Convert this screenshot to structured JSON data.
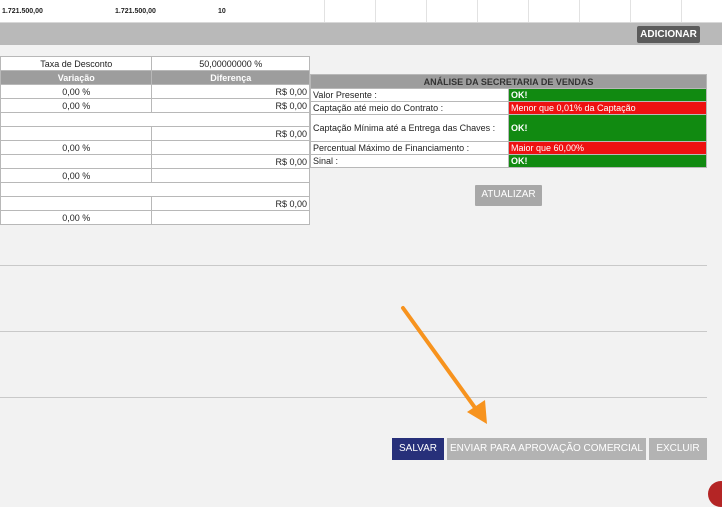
{
  "summary_row": {
    "val1": "1.721.500,00",
    "val2": "1.721.500,00",
    "val3": "10"
  },
  "toolbar": {
    "add_label": "ADICIONAR"
  },
  "discount": {
    "label": "Taxa de Desconto",
    "value": "50,00000000 %"
  },
  "variance_table": {
    "headers": [
      "Variação",
      "Diferença"
    ],
    "rows": [
      [
        "0,00 %",
        "R$  0,00"
      ],
      [
        "0,00 %",
        "R$  0,00"
      ],
      [
        "",
        ""
      ],
      [
        "",
        "R$  0,00"
      ],
      [
        "0,00 %",
        ""
      ],
      [
        "",
        "R$  0,00"
      ],
      [
        "0,00 %",
        ""
      ],
      [
        "",
        ""
      ],
      [
        "",
        "R$  0,00"
      ],
      [
        "0,00 %",
        ""
      ]
    ]
  },
  "analysis": {
    "title": "ANÁLISE DA SECRETARIA DE VENDAS",
    "rows": [
      {
        "label": "Valor Presente :",
        "status": "OK!",
        "state": "ok"
      },
      {
        "label": "Captação até meio do Contrato :",
        "status": "Menor que 0,01% da Captação",
        "state": "bad"
      },
      {
        "label": "Captação Mínima até a Entrega das Chaves :",
        "status": "OK!",
        "state": "ok"
      },
      {
        "label": "Percentual Máximo de Financiamento :",
        "status": "Maior que 60,00%",
        "state": "bad"
      },
      {
        "label": "Sinal :",
        "status": "OK!",
        "state": "ok"
      }
    ],
    "update_label": "ATUALIZAR"
  },
  "actions": {
    "save_label": "SALVAR",
    "send_label": "ENVIAR PARA APROVAÇÃO COMERCIAL",
    "delete_label": "EXCLUIR"
  },
  "colors": {
    "ok": "#118a11",
    "bad": "#ee1111",
    "save": "#27307a",
    "arrow": "#f7931e"
  }
}
